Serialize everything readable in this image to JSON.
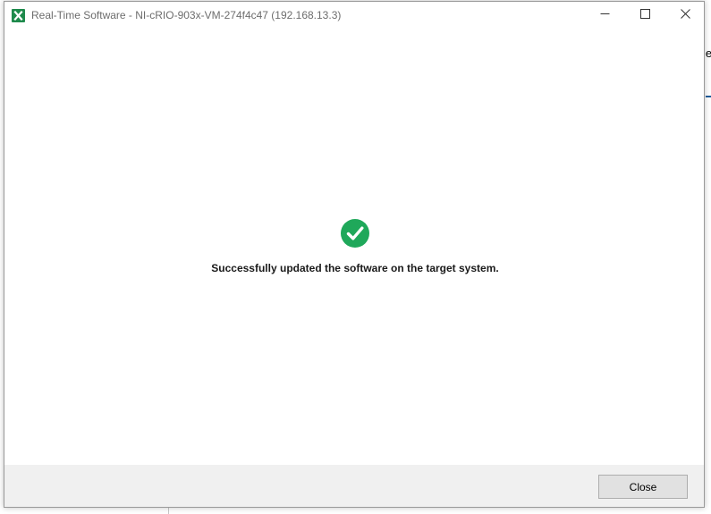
{
  "window": {
    "title": "Real-Time Software - NI-cRIO-903x-VM-274f4c47 (192.168.13.3)",
    "app_icon": "ni-app-icon",
    "controls": {
      "minimize_icon": "minimize-icon",
      "maximize_icon": "maximize-icon",
      "close_icon": "close-icon"
    }
  },
  "status": {
    "icon": "success-check-icon",
    "icon_color": "#1fa85a",
    "message": "Successfully updated the software on the target system."
  },
  "footer": {
    "close_label": "Close"
  },
  "background": {
    "partial_text": "le",
    "accent_color": "#1f5b9a"
  }
}
